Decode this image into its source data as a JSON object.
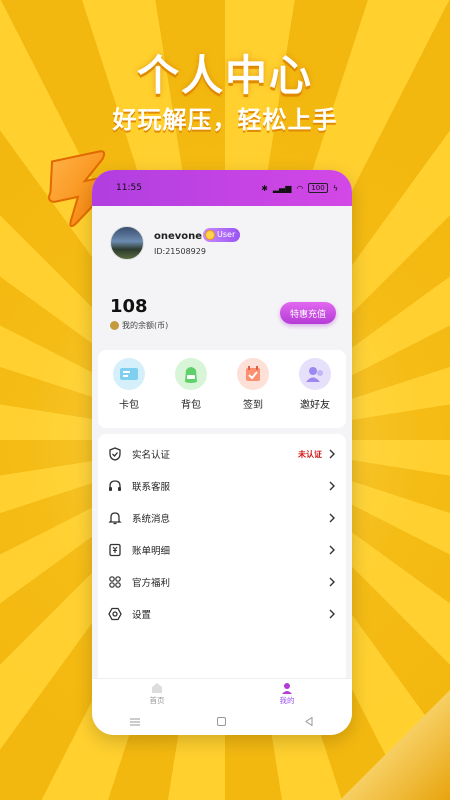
{
  "promo": {
    "title": "个人中心",
    "subtitle": "好玩解压，轻松上手"
  },
  "status_bar": {
    "time": "11:55",
    "battery": "100"
  },
  "profile": {
    "username": "onevone",
    "badge": "User",
    "user_id": "ID:21508929"
  },
  "balance": {
    "amount": "108",
    "label": "我的余额(币)",
    "recharge_button": "特惠充值"
  },
  "quick_actions": [
    {
      "label": "卡包",
      "icon": "card-wallet-icon"
    },
    {
      "label": "背包",
      "icon": "backpack-icon"
    },
    {
      "label": "签到",
      "icon": "calendar-checkin-icon"
    },
    {
      "label": "邀好友",
      "icon": "invite-friends-icon"
    }
  ],
  "menu": [
    {
      "label": "实名认证",
      "status": "未认证",
      "icon": "verify-shield-icon"
    },
    {
      "label": "联系客服",
      "status": "",
      "icon": "headset-icon"
    },
    {
      "label": "系统消息",
      "status": "",
      "icon": "bell-icon"
    },
    {
      "label": "账单明细",
      "status": "",
      "icon": "bill-icon"
    },
    {
      "label": "官方福利",
      "status": "",
      "icon": "grid-knot-icon"
    },
    {
      "label": "设置",
      "status": "",
      "icon": "settings-hex-icon"
    }
  ],
  "tabbar": {
    "home": "首页",
    "mine": "我的"
  },
  "colors": {
    "accent": "#b43bd6",
    "background": "#f7c21c",
    "warning": "#d11a1a"
  }
}
